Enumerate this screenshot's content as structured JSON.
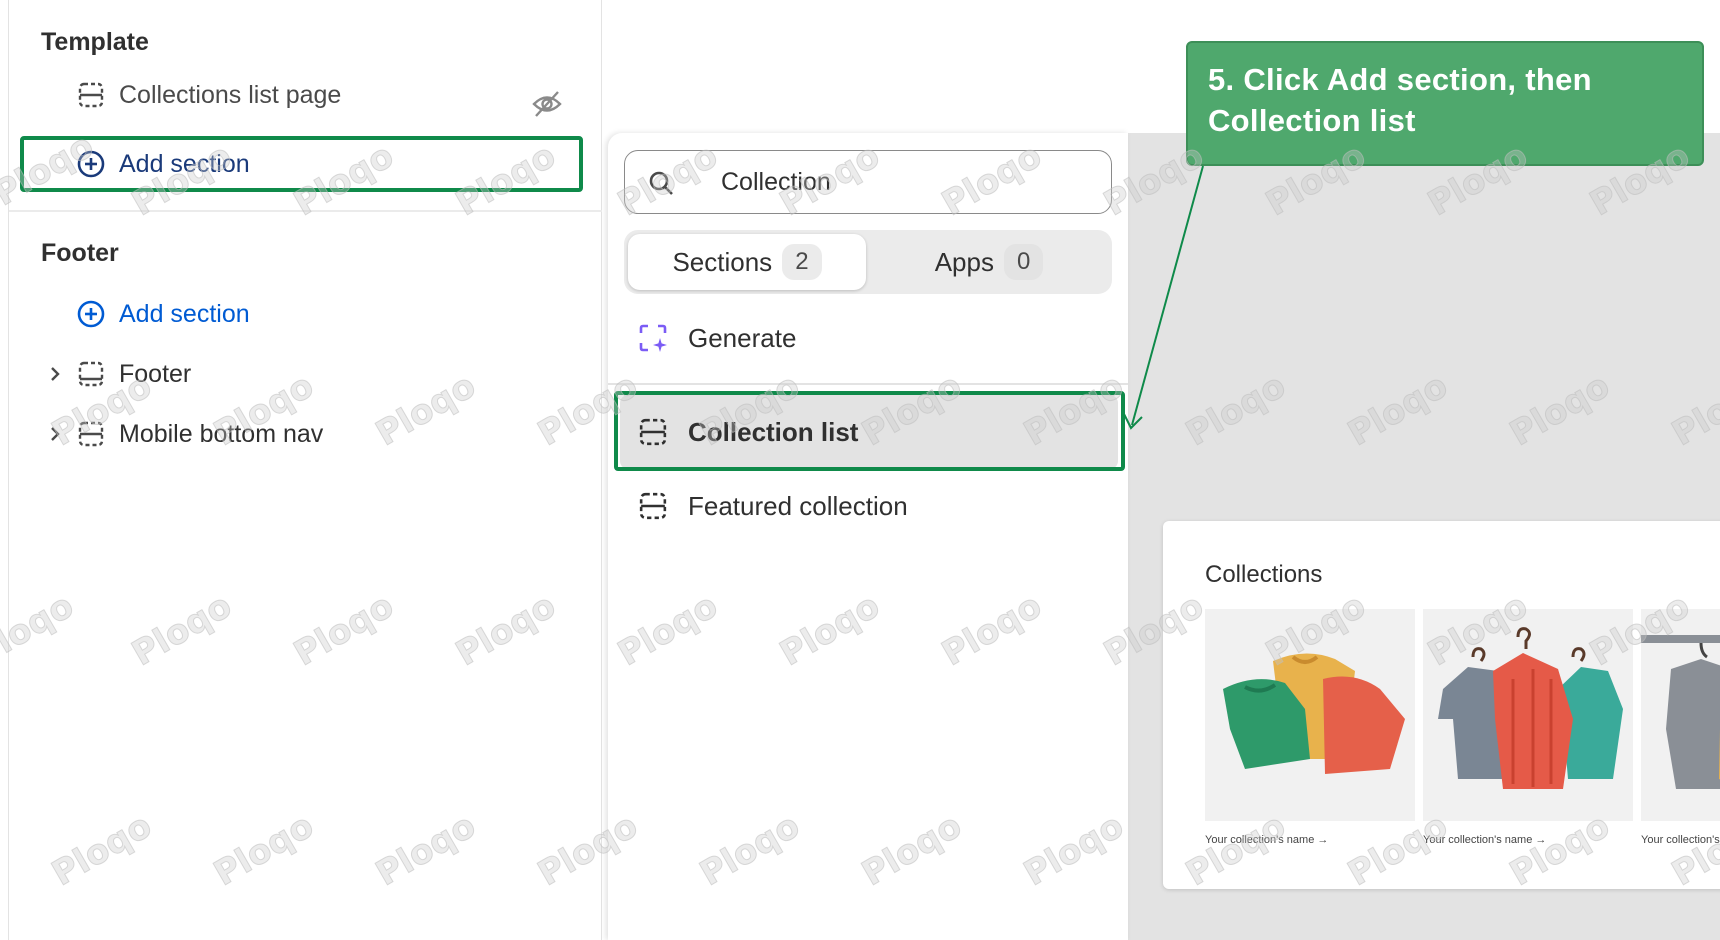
{
  "sidebar": {
    "template_title": "Template",
    "template_items": [
      {
        "label": "Collections list page",
        "icon": "section-icon",
        "hidden_icon": "eye-slash-icon"
      }
    ],
    "template_add_section": "Add section",
    "footer_title": "Footer",
    "footer_add_section": "Add section",
    "footer_items": [
      {
        "label": "Footer",
        "icon": "footer-section-icon"
      },
      {
        "label": "Mobile bottom nav",
        "icon": "section-icon"
      }
    ]
  },
  "picker": {
    "search_value": "Collection",
    "tabs": [
      {
        "label": "Sections",
        "count": "2",
        "active": true
      },
      {
        "label": "Apps",
        "count": "0",
        "active": false
      }
    ],
    "generate_label": "Generate",
    "results": [
      {
        "label": "Collection list",
        "selected": true
      },
      {
        "label": "Featured collection",
        "selected": false
      }
    ]
  },
  "preview": {
    "title": "Collections",
    "tiles": [
      {
        "caption": "Your collection's name →"
      },
      {
        "caption": "Your collection's name →"
      },
      {
        "caption": "Your collection's"
      }
    ]
  },
  "callout": {
    "line1": "5. Click Add section, then",
    "line2": "Collection list"
  },
  "watermark": "Ploqo",
  "colors": {
    "highlight": "#0f8a4a",
    "callout_bg": "#4fa86d",
    "link_blue": "#005bd3",
    "generate_purple": "#7b5cf5"
  }
}
